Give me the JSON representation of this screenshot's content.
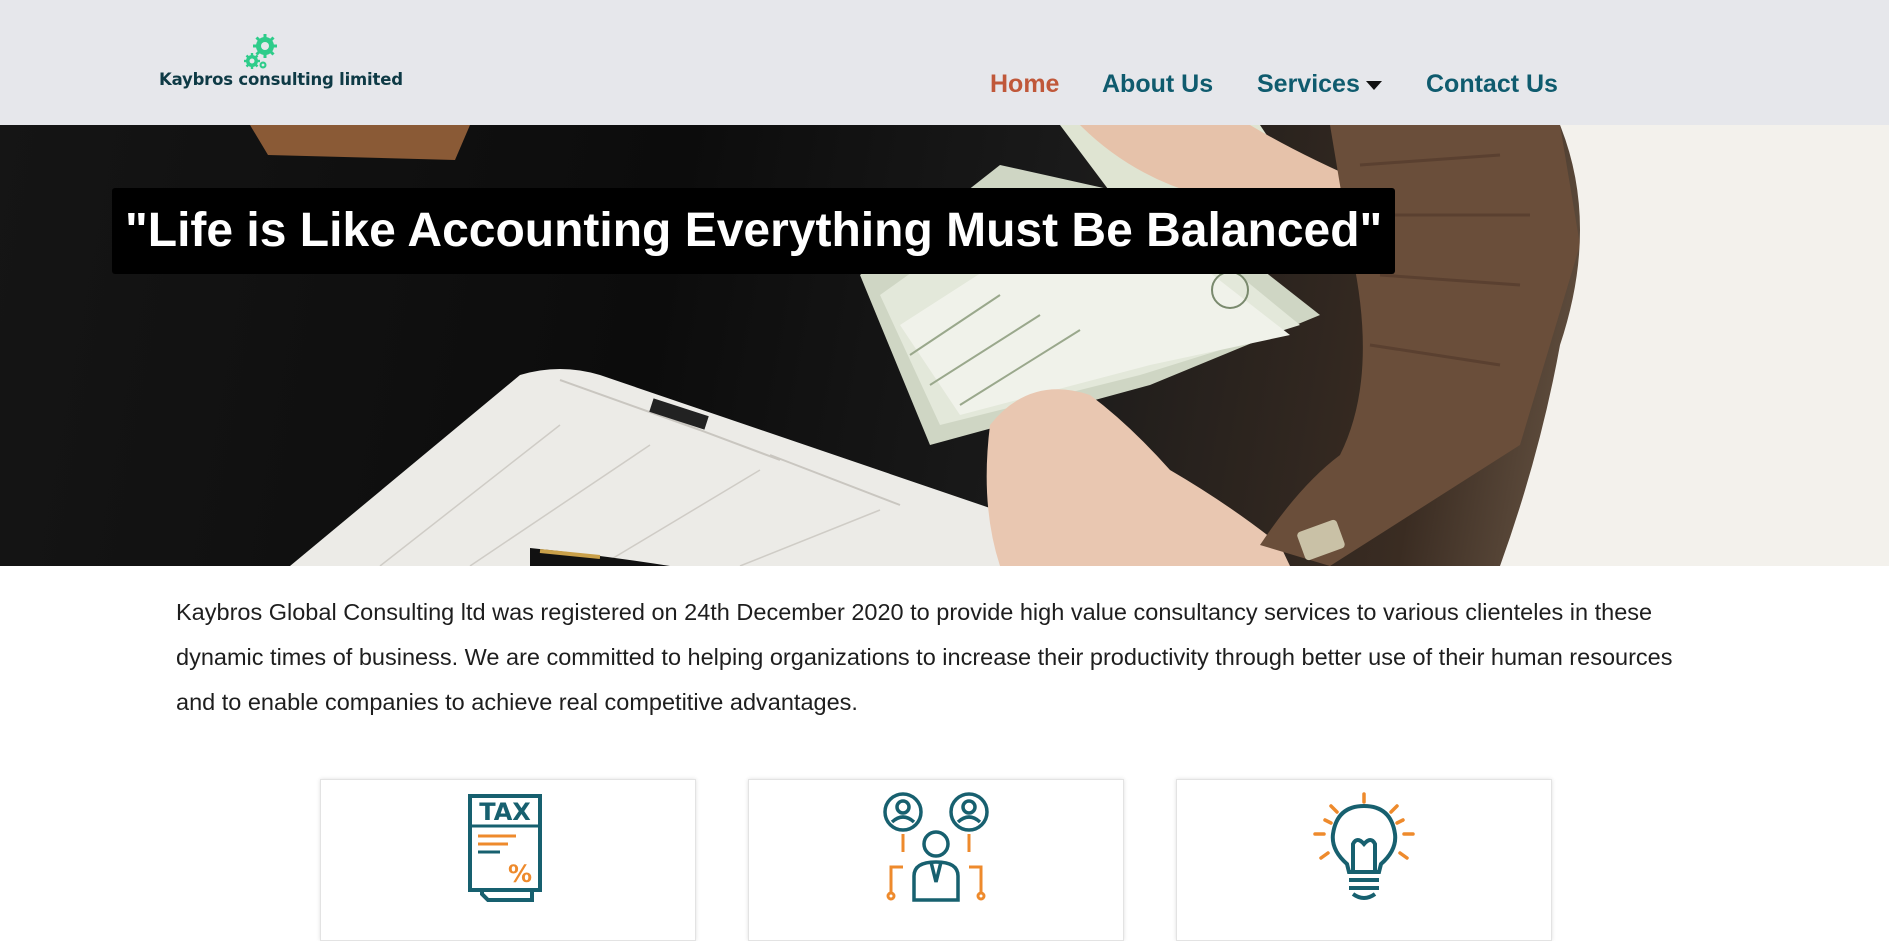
{
  "brand": {
    "name": "Kaybros consulting limited",
    "logo_icon": "gears-icon"
  },
  "nav": {
    "items": [
      {
        "label": "Home",
        "active": true
      },
      {
        "label": "About Us",
        "active": false
      },
      {
        "label": "Services",
        "active": false,
        "has_dropdown": true
      },
      {
        "label": "Contact Us",
        "active": false
      }
    ]
  },
  "hero": {
    "quote": "\"Life is Like Accounting Everything Must Be Balanced\""
  },
  "intro": {
    "text": "Kaybros Global Consulting ltd was registered on 24th December 2020 to provide high value consultancy services to various clienteles in these dynamic times of business. We are committed to helping organizations to increase their productivity through better use of their human resources and to enable companies to achieve real competitive advantages."
  },
  "cards": [
    {
      "icon": "tax-document-icon",
      "icon_label": "TAX"
    },
    {
      "icon": "consultant-people-icon"
    },
    {
      "icon": "lightbulb-idea-icon"
    }
  ],
  "colors": {
    "header_bg": "#e6e7eb",
    "nav_text": "#0f5b6e",
    "nav_active": "#c0583a",
    "logo_green": "#2ecc8a",
    "icon_teal": "#17606f",
    "icon_orange": "#ee8a2c"
  }
}
